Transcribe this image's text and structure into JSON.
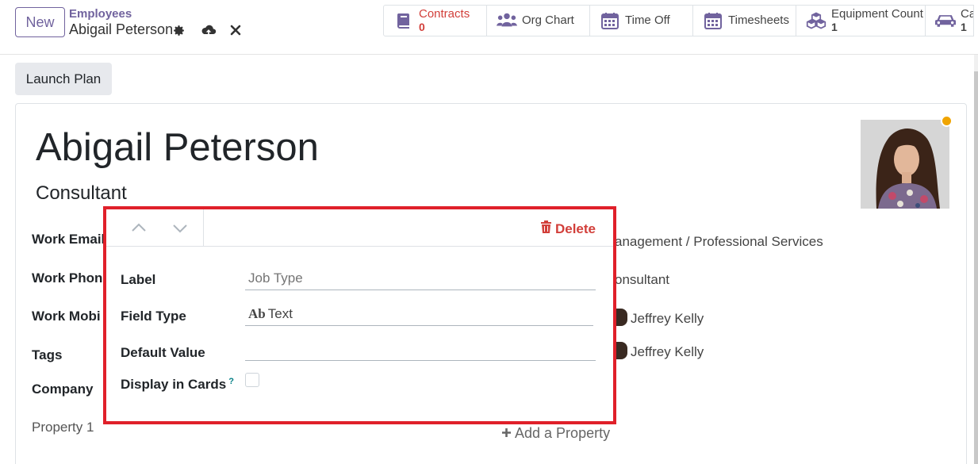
{
  "header": {
    "new_label": "New",
    "breadcrumb_parent": "Employees",
    "breadcrumb_current": "Abigail Peterson"
  },
  "stats": [
    {
      "label": "Contracts",
      "value": "0",
      "icon": "book-icon",
      "danger": true
    },
    {
      "label": "Org Chart",
      "value": "",
      "icon": "users-icon"
    },
    {
      "label": "Time Off",
      "value": "",
      "icon": "calendar-icon"
    },
    {
      "label": "Timesheets",
      "value": "",
      "icon": "calendar-icon"
    },
    {
      "label": "Equipment Count",
      "value": "1",
      "icon": "cubes-icon"
    },
    {
      "label": "Ca",
      "value": "1",
      "icon": "car-icon"
    }
  ],
  "toolbar": {
    "launch_plan_label": "Launch Plan"
  },
  "employee": {
    "name": "Abigail Peterson",
    "job_title": "Consultant",
    "status_color": "#f0a400"
  },
  "fields": {
    "work_email": "Work Email",
    "work_phone": "Work Phone",
    "work_mobile": "Work Mobi",
    "tags": "Tags",
    "company": "Company",
    "department_value": "anagement / Professional Services",
    "job_position_value": "onsultant",
    "manager_value": "Jeffrey Kelly",
    "coach_value": "Jeffrey Kelly",
    "property_1": "Property 1",
    "add_property": "Add a Property"
  },
  "popover": {
    "delete_label": "Delete",
    "label_label": "Label",
    "label_placeholder": "Job Type",
    "field_type_label": "Field Type",
    "field_type_prefix": "Ab",
    "field_type_value": "Text",
    "default_value_label": "Default Value",
    "default_value": "",
    "display_in_cards_label": "Display in Cards",
    "tooltip_marker": "?",
    "display_in_cards_checked": false,
    "highlight_color": "#e0202a"
  },
  "colors": {
    "brand": "#71639e",
    "danger": "#d23f3a"
  }
}
